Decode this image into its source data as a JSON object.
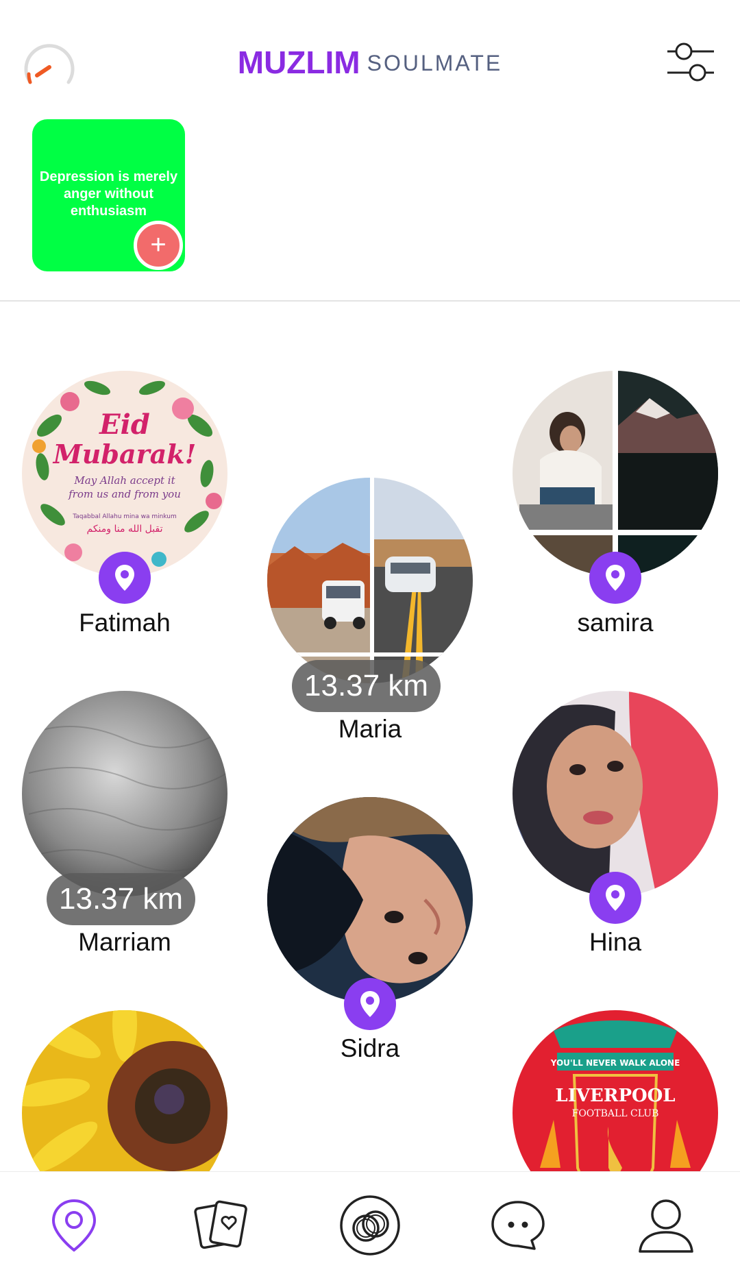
{
  "header": {
    "logo_bold": "MUZLIM",
    "logo_light": "SOULMATE"
  },
  "story": {
    "text": "Depression is merely anger without enthusiasm",
    "add_label": "+"
  },
  "profiles": [
    {
      "name": "Fatimah",
      "distance": null
    },
    {
      "name": "Maria",
      "distance": "13.37 km"
    },
    {
      "name": "samira",
      "distance": null
    },
    {
      "name": "Marriam",
      "distance": "13.37 km"
    },
    {
      "name": "Hina",
      "distance": null
    },
    {
      "name": "Sidra",
      "distance": null
    }
  ],
  "avatar_texts": {
    "eid_title_1": "Eid",
    "eid_title_2": "Mubarak!",
    "eid_sub_1": "May Allah accept it",
    "eid_sub_2": "from us and from you",
    "eid_sub_3": "Taqabbal Allahu mina wa minkum",
    "eid_arabic": "تقبل الله منا ومنكم",
    "lfc_banner": "YOU'LL NEVER WALK ALONE",
    "lfc_name": "LIVERPOOL",
    "lfc_sub": "FOOTBALL CLUB"
  },
  "nav": [
    "discover",
    "cards",
    "matches",
    "chat",
    "profile"
  ],
  "colors": {
    "brand": "#8a2be2",
    "logo_light": "#556080",
    "pin": "#8a3ef0",
    "story_bg": "#00ff44",
    "story_add": "#f26b6b",
    "speed_needle": "#ef5a24",
    "nav_active": "#8a3ef0"
  }
}
